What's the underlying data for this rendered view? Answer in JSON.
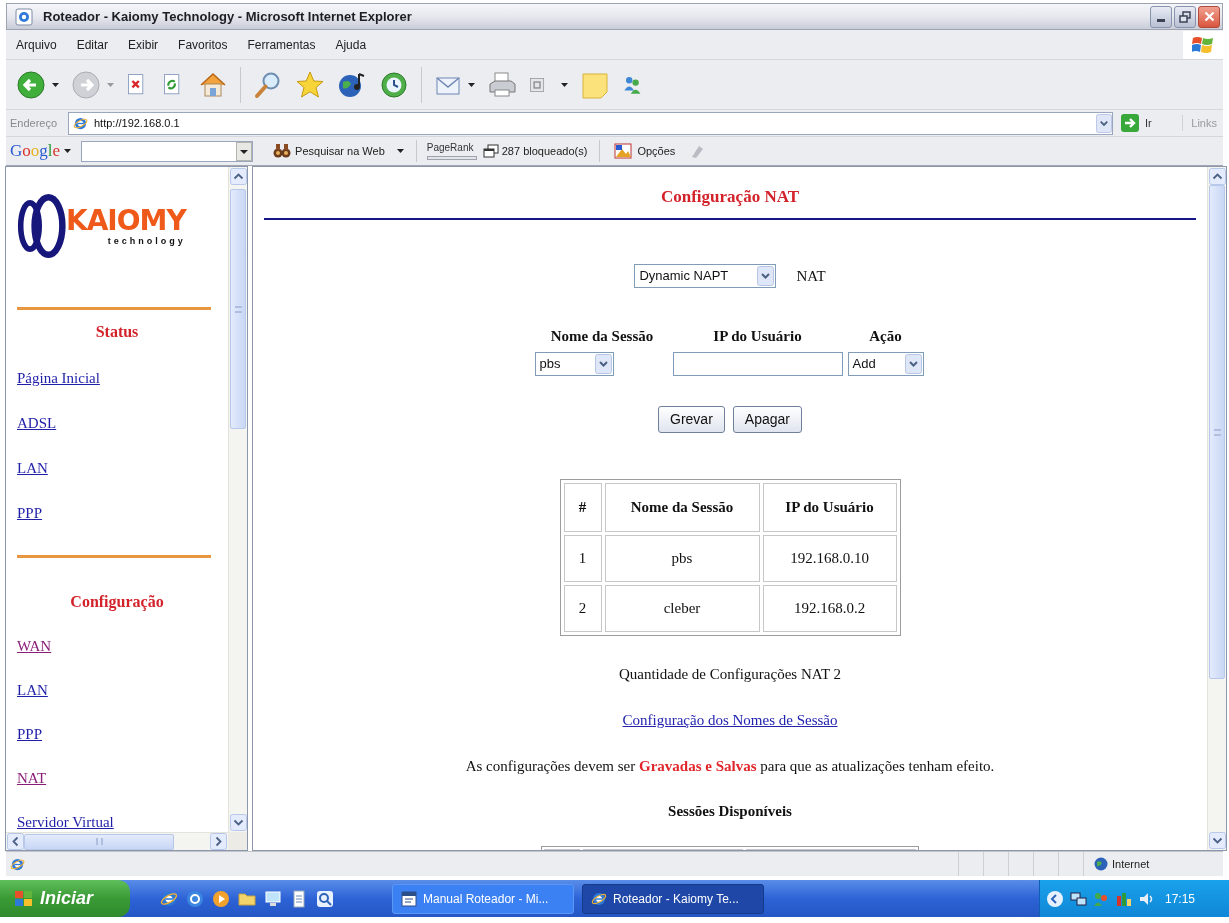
{
  "window": {
    "title": "Roteador - Kaiomy Technology - Microsoft Internet Explorer"
  },
  "menu_bar": [
    "Arquivo",
    "Editar",
    "Exibir",
    "Favoritos",
    "Ferramentas",
    "Ajuda"
  ],
  "address_bar": {
    "label": "Endereço",
    "value": "http://192.168.0.1",
    "go_label": "Ir",
    "links_label": "Links"
  },
  "google_toolbar": {
    "logo": "Google",
    "search_button": "Pesquisar na Web",
    "pagerank_label": "PageRank",
    "popups_blocked": "287 bloqueado(s)",
    "options": "Opções"
  },
  "sidebar": {
    "logo": {
      "name": "KAIOMY",
      "tagline": "technology"
    },
    "sections": [
      {
        "heading": "Status",
        "links": [
          {
            "label": "Página Inicial",
            "visited": false
          },
          {
            "label": "ADSL",
            "visited": false
          },
          {
            "label": "LAN",
            "visited": false
          },
          {
            "label": "PPP",
            "visited": false
          }
        ]
      },
      {
        "heading": "Configuração",
        "links": [
          {
            "label": "WAN",
            "visited": true
          },
          {
            "label": "LAN",
            "visited": false
          },
          {
            "label": "PPP",
            "visited": false
          },
          {
            "label": "NAT",
            "visited": true
          },
          {
            "label": "Servidor Virtual",
            "visited": false
          }
        ]
      }
    ]
  },
  "page": {
    "title": "Configuração NAT",
    "nat_mode": {
      "value": "Dynamic NAPT",
      "label": "NAT"
    },
    "fields": [
      {
        "label": "Nome da Sessão",
        "kind": "select",
        "value": "pbs"
      },
      {
        "label": "IP do Usuário",
        "kind": "input"
      },
      {
        "label": "Ação",
        "kind": "select",
        "value": "Add"
      }
    ],
    "buttons": [
      "Grevar",
      "Apagar"
    ],
    "table": {
      "columns": [
        "#",
        "Nome da Sessão",
        "IP do Usuário"
      ],
      "rows": [
        [
          "1",
          "pbs",
          "192.168.0.10"
        ],
        [
          "2",
          "cleber",
          "192.168.0.2"
        ]
      ]
    },
    "count": "Quantidade de Configurações NAT 2",
    "link": "Configuração dos Nomes de Sessão",
    "notice": "As configurações devem ser **Gravadas e Salvas** para que as atualizações tenham efeito.",
    "section_heading": "Sessões Disponíveis"
  },
  "status_bar": {
    "zone": "Internet"
  },
  "taskbar": {
    "start": "Iniciar",
    "tasks": [
      {
        "label": "Manual Roteador - Mi...",
        "selected": false
      },
      {
        "label": "Roteador - Kaiomy Te...",
        "selected": true
      }
    ],
    "clock": "17:15"
  }
}
